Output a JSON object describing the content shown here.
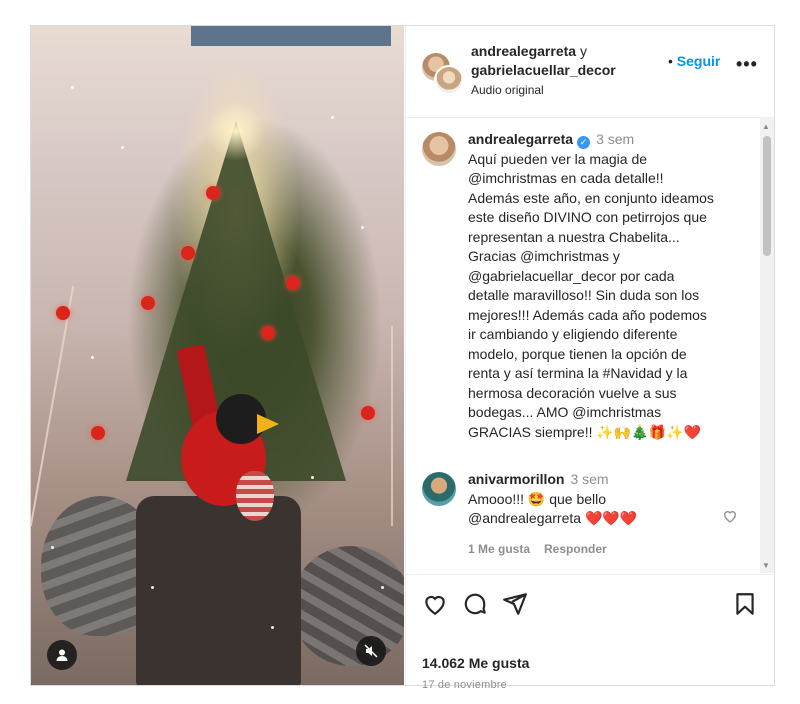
{
  "post": {
    "header": {
      "username_1": "andrealegarreta",
      "joiner": " y",
      "username_2": "gabrielacuellar_decor",
      "audio": "Audio original",
      "follow_label": "Seguir",
      "more_label": "•••"
    },
    "caption": {
      "username": "andrealegarreta",
      "time": "3 sem",
      "lines": [
        "Aquí pueden ver la magia de",
        "@imchristmas en cada detalle!!",
        "Además este año, en conjunto ideamos",
        "este diseño DIVINO con petirrojos que",
        "representan a nuestra Chabelita...",
        "Gracias @imchristmas y",
        "@gabrielacuellar_decor por cada",
        "detalle maravilloso!! Sin duda son los",
        "mejores!!! Además cada año podemos",
        "ir cambiando y eligiendo diferente",
        "modelo, porque tienen la opción de",
        "renta y así termina la #Navidad y la",
        "hermosa decoración vuelve a sus",
        "bodegas... AMO @imchristmas",
        "GRACIAS siempre!! ✨🙌🎄🎁✨❤️"
      ]
    },
    "comment": {
      "username": "anivarmorillon",
      "time": "3 sem",
      "line1": "Amooo!!! 🤩 que bello",
      "line2": "@andrealegarreta ❤️❤️❤️",
      "likes": "1 Me gusta",
      "reply": "Responder"
    },
    "likes": "14.062 Me gusta",
    "date": "17 de noviembre"
  },
  "colors": {
    "accent": "#0095f6",
    "text": "#262626",
    "muted": "#8e8e8e",
    "border": "#dbdbdb",
    "verified": "#3897f0"
  },
  "icons": [
    "user-icon",
    "mute-icon",
    "more-icon",
    "verified-icon",
    "heart-icon",
    "comment-icon",
    "share-icon",
    "bookmark-icon"
  ]
}
